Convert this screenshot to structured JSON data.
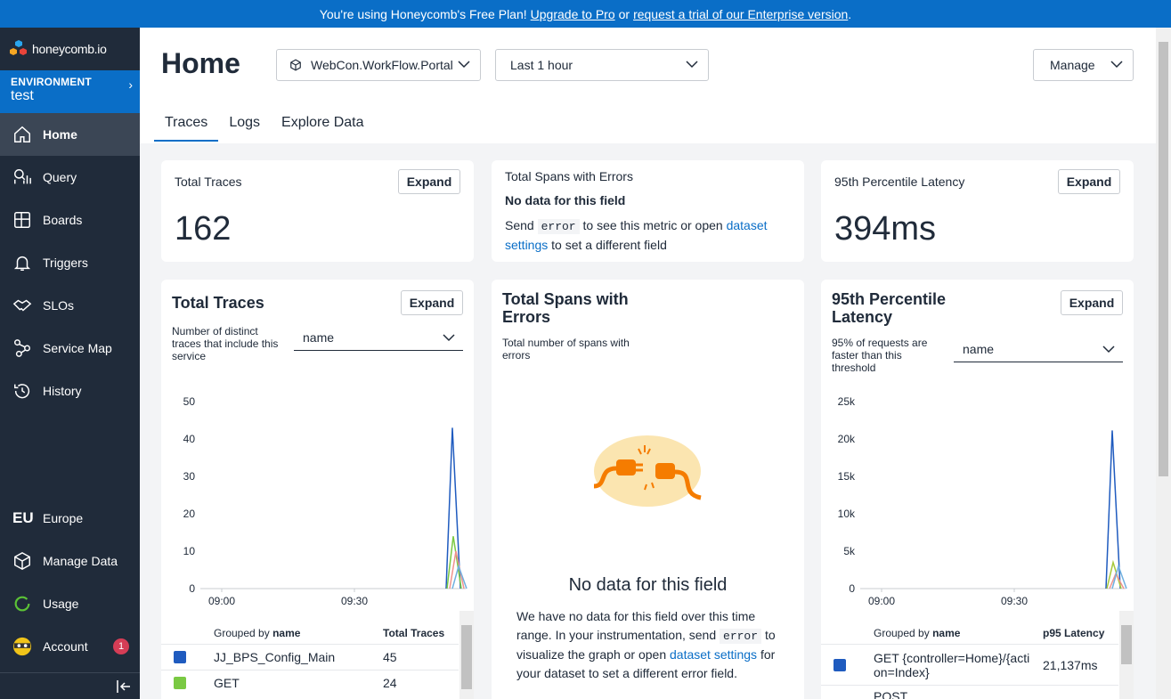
{
  "banner": {
    "text_before": "You're using Honeycomb's Free Plan!",
    "upgrade_link": "Upgrade to Pro",
    "or": "or",
    "trial_link": "request a trial of our Enterprise version",
    "period": "."
  },
  "sidebar": {
    "logo": "honeycomb.io",
    "env_label": "ENVIRONMENT",
    "env_value": "test",
    "items": [
      {
        "label": "Home",
        "icon": "home-icon"
      },
      {
        "label": "Query",
        "icon": "query-icon"
      },
      {
        "label": "Boards",
        "icon": "boards-icon"
      },
      {
        "label": "Triggers",
        "icon": "bell-icon"
      },
      {
        "label": "SLOs",
        "icon": "handshake-icon"
      },
      {
        "label": "Service Map",
        "icon": "service-map-icon"
      },
      {
        "label": "History",
        "icon": "history-icon"
      }
    ],
    "bottom_items": [
      {
        "label": "Europe",
        "icon": "eu-icon",
        "icon_text": "EU"
      },
      {
        "label": "Manage Data",
        "icon": "cube-icon"
      },
      {
        "label": "Usage",
        "icon": "usage-ring-icon"
      },
      {
        "label": "Account",
        "icon": "avatar-icon",
        "badge": "1"
      }
    ]
  },
  "header": {
    "title": "Home",
    "dataset": "WebCon.WorkFlow.Portal",
    "time_range": "Last 1 hour",
    "manage": "Manage",
    "tabs": [
      "Traces",
      "Logs",
      "Explore Data"
    ]
  },
  "summary": {
    "total_traces": {
      "label": "Total Traces",
      "value": "162",
      "button": "Expand"
    },
    "spans_errors": {
      "label": "Total Spans with Errors",
      "no_data": "No data for this field",
      "send": "Send",
      "code": "error",
      "mid": "to see this metric or open",
      "link": "dataset settings",
      "end": "to set a different field"
    },
    "latency": {
      "label": "95th Percentile Latency",
      "value": "394ms",
      "button": "Expand"
    }
  },
  "panels": {
    "traces": {
      "title": "Total Traces",
      "button": "Expand",
      "desc": "Number of distinct traces that include this service",
      "group_select": "name",
      "table_header_grouped": "Grouped by",
      "table_header_field": "name",
      "table_header_metric": "Total Traces",
      "rows": [
        {
          "name": "JJ_BPS_Config_Main",
          "value": "45",
          "color": "#1f5bbf"
        },
        {
          "name": "GET",
          "value": "24",
          "color": "#7ac943"
        }
      ]
    },
    "errors": {
      "title": "Total Spans with Errors",
      "desc": "Total number of spans with errors",
      "empty_title": "No data for this field",
      "empty_p1": "We have no data for this field over this time range. In your instrumentation, send",
      "empty_code": "error",
      "empty_p2": "to visualize the graph or open",
      "empty_link": "dataset settings",
      "empty_p3": "for your dataset to set a different error field."
    },
    "latency": {
      "title": "95th Percentile Latency",
      "button": "Expand",
      "desc": "95% of requests are faster than this threshold",
      "group_select": "name",
      "table_header_grouped": "Grouped by",
      "table_header_field": "name",
      "table_header_metric": "p95 Latency",
      "rows": [
        {
          "name": "GET {controller=Home}/{action=Index}",
          "value": "21,137ms",
          "color": "#1f5bbf"
        },
        {
          "name": "POST",
          "value": "",
          "color": "#7ac943"
        }
      ]
    }
  },
  "chart_data": [
    {
      "type": "line",
      "y_ticks": [
        "50",
        "40",
        "30",
        "20",
        "10",
        "0"
      ],
      "x_ticks": [
        "09:00",
        "09:30"
      ],
      "ylim": [
        0,
        50
      ],
      "series": [
        {
          "color": "#1f5bbf",
          "values": [
            0,
            43,
            0
          ]
        },
        {
          "color": "#7ac943",
          "values": [
            0,
            14,
            0
          ]
        },
        {
          "color": "#f0928d",
          "values": [
            0,
            10,
            0
          ]
        },
        {
          "color": "#6fb0e0",
          "values": [
            0,
            6,
            0
          ]
        }
      ]
    },
    {
      "type": "line",
      "y_ticks": [
        "25k",
        "20k",
        "15k",
        "10k",
        "5k",
        "0"
      ],
      "x_ticks": [
        "09:00",
        "09:30"
      ],
      "ylim": [
        0,
        25000
      ],
      "series": [
        {
          "color": "#1f5bbf",
          "values": [
            0,
            21137,
            0
          ]
        },
        {
          "color": "#a7c83a",
          "values": [
            0,
            3500,
            0
          ]
        },
        {
          "color": "#f0928d",
          "values": [
            0,
            2000,
            0
          ]
        },
        {
          "color": "#6fb0e0",
          "values": [
            0,
            3000,
            0
          ]
        }
      ]
    }
  ]
}
